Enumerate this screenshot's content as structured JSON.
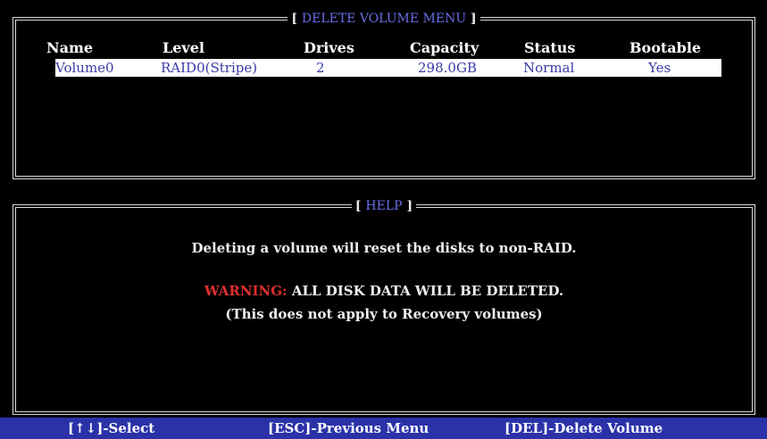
{
  "top_panel": {
    "title": "DELETE VOLUME MENU",
    "columns": [
      "Name",
      "Level",
      "Drives",
      "Capacity",
      "Status",
      "Bootable"
    ],
    "rows": [
      {
        "name": "Volume0",
        "level": "RAID0(Stripe)",
        "drives": "2",
        "capacity": "298.0GB",
        "status": "Normal",
        "bootable": "Yes"
      }
    ]
  },
  "help_panel": {
    "title": "HELP",
    "line1": "Deleting a volume will reset the disks to non-RAID.",
    "warning_label": "WARNING:",
    "warning_text": " ALL DISK DATA WILL BE DELETED.",
    "line3": "(This does not apply to Recovery volumes)"
  },
  "footer": {
    "select": "[↑↓]-Select",
    "previous": "[ESC]-Previous Menu",
    "delete": "[DEL]-Delete Volume"
  },
  "colors": {
    "background": "#000000",
    "title_text": "#6a6ee8",
    "selected_row_bg": "#ffffff",
    "selected_row_text": "#3a3aa8",
    "warning": "#e03030",
    "footer_bg": "#2b32a8"
  }
}
